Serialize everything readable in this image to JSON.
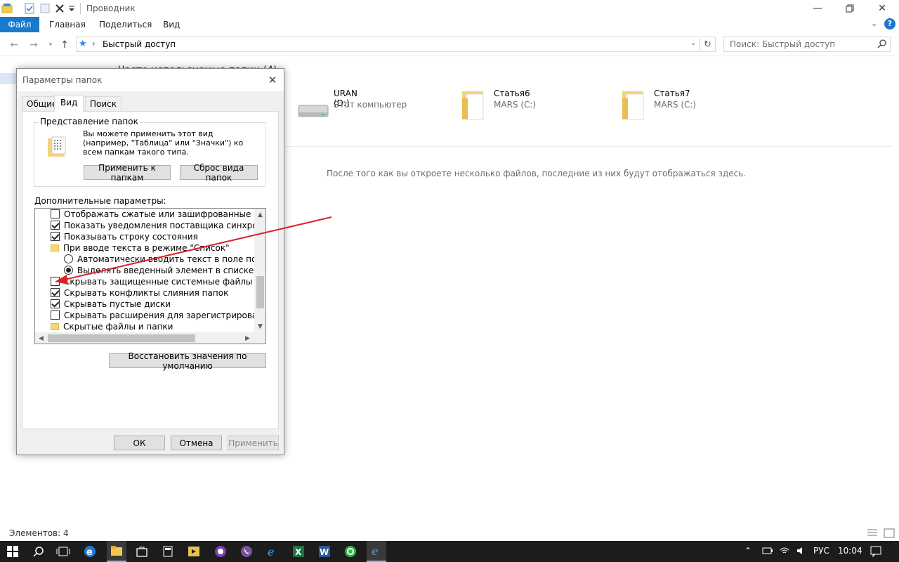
{
  "window": {
    "title": "Проводник",
    "quick_access_toolbar": [
      "explorer-icon",
      "properties-icon",
      "new-folder-icon",
      "delete-icon",
      "customize-icon"
    ]
  },
  "ribbon": {
    "tabs": [
      {
        "label": "Файл"
      },
      {
        "label": "Главная"
      },
      {
        "label": "Поделиться"
      },
      {
        "label": "Вид"
      }
    ]
  },
  "address": {
    "path": "Быстрый доступ",
    "search_placeholder": "Поиск: Быстрый доступ"
  },
  "content": {
    "group_header": "Часто используемые папки (4)",
    "items": [
      {
        "title": "URAN (D:)",
        "subtitle": "Этот компьютер"
      },
      {
        "title": "Статья6",
        "subtitle": "MARS (C:)"
      },
      {
        "title": "Статья7",
        "subtitle": "MARS (C:)"
      }
    ],
    "recent_message": "После того как вы откроете несколько файлов, последние из них будут отображаться здесь."
  },
  "statusbar": {
    "items_count": "Элементов: 4"
  },
  "taskbar": {
    "lang": "РУС",
    "time": "10:04"
  },
  "dialog": {
    "title": "Параметры папок",
    "tabs": [
      {
        "label": "Общие"
      },
      {
        "label": "Вид"
      },
      {
        "label": "Поиск"
      }
    ],
    "folder_view": {
      "label": "Представление папок",
      "description": "Вы можете применить этот вид (например, \"Таблица\" или \"Значки\") ко всем папкам такого типа.",
      "apply_button": "Применить к папкам",
      "reset_button": "Сброс вида папок"
    },
    "advanced_label": "Дополнительные параметры:",
    "advanced_items": [
      {
        "text": "Отображать сжатые или зашифрованные файлы NTFS",
        "kind": "checkbox",
        "checked": false,
        "indent": 0
      },
      {
        "text": "Показать уведомления поставщика синхронизации",
        "kind": "checkbox",
        "checked": true,
        "indent": 0
      },
      {
        "text": "Показывать строку состояния",
        "kind": "checkbox",
        "checked": true,
        "indent": 0
      },
      {
        "text": "При вводе текста в режиме \"Список\"",
        "kind": "folder",
        "checked": false,
        "indent": 0
      },
      {
        "text": "Автоматически вводить текст в поле поиска",
        "kind": "radio",
        "checked": false,
        "indent": 1
      },
      {
        "text": "Выделять введенный элемент в списке",
        "kind": "radio",
        "checked": true,
        "indent": 1
      },
      {
        "text": "Скрывать защищенные системные файлы (рекомендуется)",
        "kind": "checkbox",
        "checked": false,
        "indent": 0
      },
      {
        "text": "Скрывать конфликты слияния папок",
        "kind": "checkbox",
        "checked": true,
        "indent": 0
      },
      {
        "text": "Скрывать пустые диски",
        "kind": "checkbox",
        "checked": true,
        "indent": 0
      },
      {
        "text": "Скрывать расширения для зарегистрированных типов файлов",
        "kind": "checkbox",
        "checked": false,
        "indent": 0
      },
      {
        "text": "Скрытые файлы и папки",
        "kind": "folder",
        "checked": false,
        "indent": 0
      }
    ],
    "restore_button": "Восстановить значения по умолчанию",
    "ok_button": "ОК",
    "cancel_button": "Отмена",
    "apply_button": "Применить",
    "annotation_color": "#d9242a"
  }
}
